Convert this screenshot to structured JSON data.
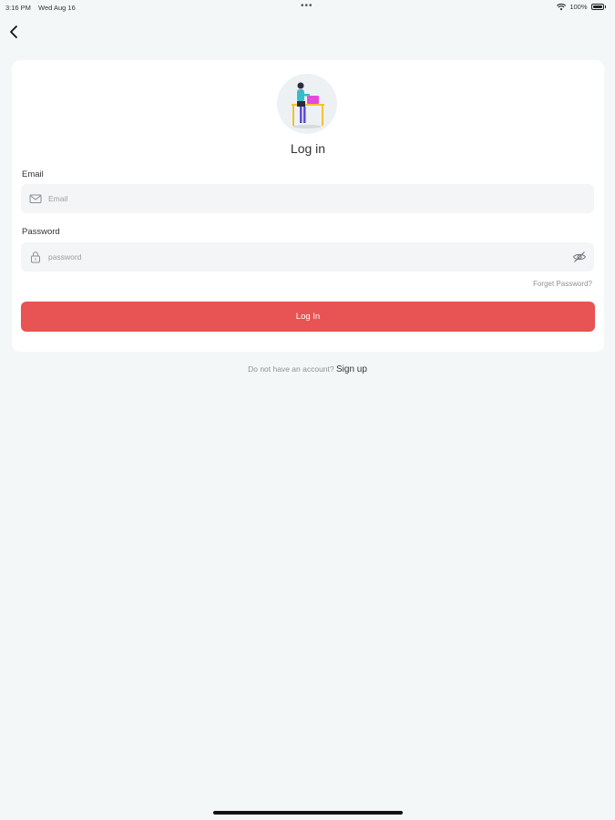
{
  "status_bar": {
    "time": "3:16 PM",
    "date": "Wed Aug 16",
    "battery": "100%"
  },
  "login_card": {
    "title": "Log in",
    "email": {
      "label": "Email",
      "placeholder": "Email",
      "value": ""
    },
    "password": {
      "label": "Password",
      "placeholder": "password",
      "value": ""
    },
    "forgot_password": "Forget Password?",
    "login_button": "Log In"
  },
  "footer": {
    "prompt": "Do not have an account?",
    "signup": "Sign up"
  },
  "colors": {
    "background": "#f4f7f8",
    "card": "#ffffff",
    "primary": "#e85353",
    "input": "#f3f5f6"
  },
  "icons": {
    "back": "chevron-left-icon",
    "email": "mail-icon",
    "password": "lock-icon",
    "password_toggle": "eye-off-icon"
  }
}
